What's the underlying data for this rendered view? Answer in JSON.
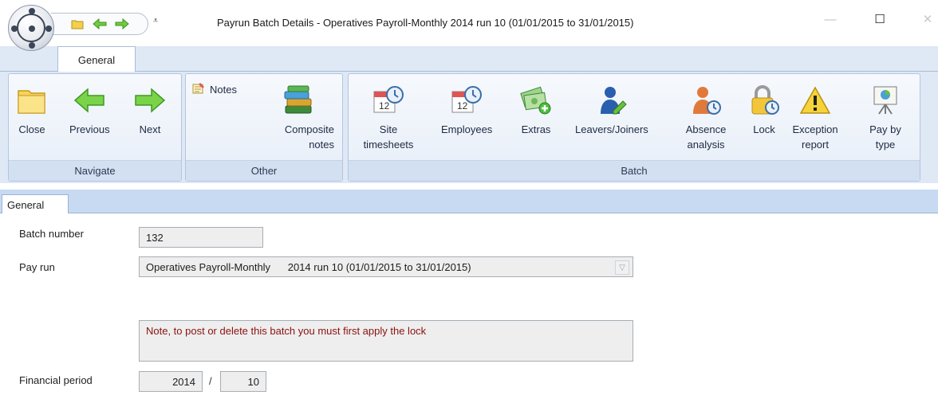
{
  "window": {
    "title": "Payrun Batch Details - Operatives Payroll-Monthly 2014 run 10 (01/01/2015 to 31/01/2015)",
    "minimize_glyph": "—",
    "maximize_glyph": "☐",
    "close_glyph": "✕",
    "qat_dropdown_glyph": "⩡"
  },
  "ribbon": {
    "active_tab": "General",
    "groups": {
      "navigate": {
        "label": "Navigate",
        "buttons": [
          {
            "label": "Close",
            "icon": "folder-icon"
          },
          {
            "label": "Previous",
            "icon": "arrow-left-icon"
          },
          {
            "label": "Next",
            "icon": "arrow-right-icon"
          }
        ]
      },
      "other": {
        "label": "Other",
        "notes_label": "Notes",
        "composite_label_1": "Composite",
        "composite_label_2": "notes"
      },
      "batch": {
        "label": "Batch",
        "site_1": "Site",
        "site_2": "timesheets",
        "employees": "Employees",
        "extras": "Extras",
        "leavers": "Leavers/Joiners",
        "absence_1": "Absence",
        "absence_2": "analysis",
        "lock": "Lock",
        "exception_1": "Exception",
        "exception_2": "report",
        "paybytype_1": "Pay by",
        "paybytype_2": "type"
      }
    }
  },
  "form": {
    "tab": "General",
    "batch_number_label": "Batch number",
    "batch_number_value": "132",
    "pay_run_label": "Pay run",
    "pay_run_value": "Operatives Payroll-Monthly      2014 run 10 (01/01/2015 to 31/01/2015)",
    "note_text": "Note, to post or delete this batch you must first apply the lock",
    "financial_period_label": "Financial period",
    "financial_year": "2014",
    "period_separator": "/",
    "financial_period": "10"
  },
  "colors": {
    "ribbon_bg": "#dfe8f5",
    "form_tabstrip_bg": "#c7daf1",
    "note_text": "#8b1010"
  }
}
